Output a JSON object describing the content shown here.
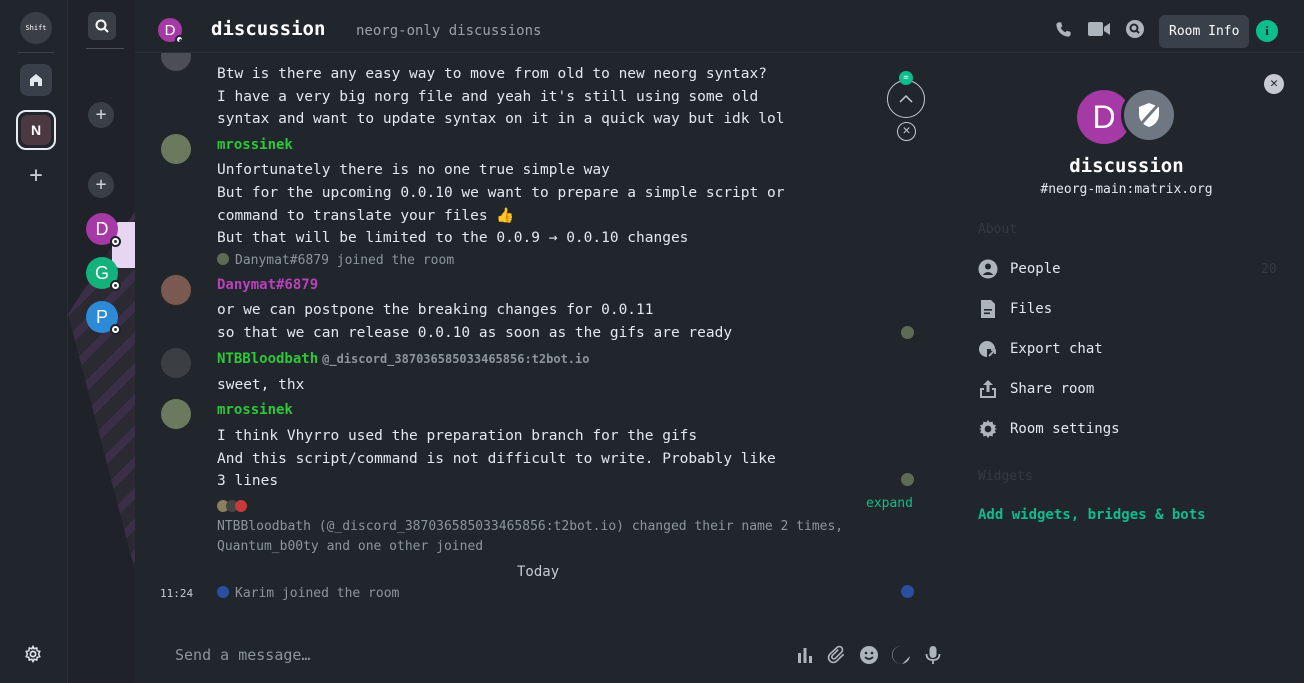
{
  "spaces": {
    "logo_text": "Shift",
    "space_letter": "N",
    "add_label": "+"
  },
  "roomlist": {
    "add_label": "+",
    "rooms": [
      {
        "letter": "D",
        "color": "#a539a5"
      },
      {
        "letter": "G",
        "color": "#13b27c"
      },
      {
        "letter": "P",
        "color": "#2d8ad6"
      }
    ]
  },
  "header": {
    "avatar_letter": "D",
    "room_name": "discussion",
    "topic": "neorg-only discussions",
    "tooltip": "Room Info",
    "info_glyph": "i"
  },
  "timeline": {
    "messages": [
      {
        "lines": [
          "Btw is there any easy way to move from old to new neorg syntax?",
          "I have a very big norg file and yeah it's still using some old",
          "syntax and want to update syntax on it in a quick way but idk lol"
        ]
      },
      {
        "sender": "mrossinek",
        "sender_color": "#2dc73a",
        "lines": [
          "Unfortunately there is no one true simple way",
          "But for the upcoming 0.0.10 we want to prepare a simple script or",
          "command to translate your files 👍",
          "But that will be limited to the 0.0.9 → 0.0.10 changes"
        ]
      },
      {
        "event": "Danymat#6879 joined the room"
      },
      {
        "sender": "Danymat#6879",
        "sender_color": "#b842b8",
        "lines": [
          "or we can postpone the breaking changes for 0.0.11",
          "so that we can release 0.0.10 as soon as the gifs are ready"
        ]
      },
      {
        "sender": "NTBBloodbath",
        "sender_color": "#2dc73a",
        "mxid": "@_discord_387036585033465856:t2bot.io",
        "lines": [
          "sweet, thx"
        ]
      },
      {
        "sender": "mrossinek",
        "sender_color": "#2dc73a",
        "lines": [
          "I think Vhyrro used the preparation branch for the gifs",
          "And this script/command is not difficult to write. Probably like",
          "3 lines"
        ]
      }
    ],
    "summary_lines": [
      "NTBBloodbath (@_discord_387036585033465856:t2bot.io) changed their name 2 times,",
      "Quantum_b00ty and one other joined"
    ],
    "expand_label": "expand",
    "date_separator": "Today",
    "last_event_time": "11:24",
    "last_event": "Karim joined the room",
    "scroll_badge": "="
  },
  "composer": {
    "placeholder": "Send a message…"
  },
  "panel": {
    "avatar_letter": "D",
    "room_name": "discussion",
    "alias": "#neorg-main:matrix.org",
    "about_heading": "About",
    "people_label": "People",
    "people_count": "20",
    "files_label": "Files",
    "export_label": "Export chat",
    "share_label": "Share room",
    "settings_label": "Room settings",
    "widgets_heading": "Widgets",
    "add_widgets_label": "Add widgets, bridges & bots"
  },
  "colors": {
    "accent": "#0dbd8b",
    "background": "#21262c"
  }
}
